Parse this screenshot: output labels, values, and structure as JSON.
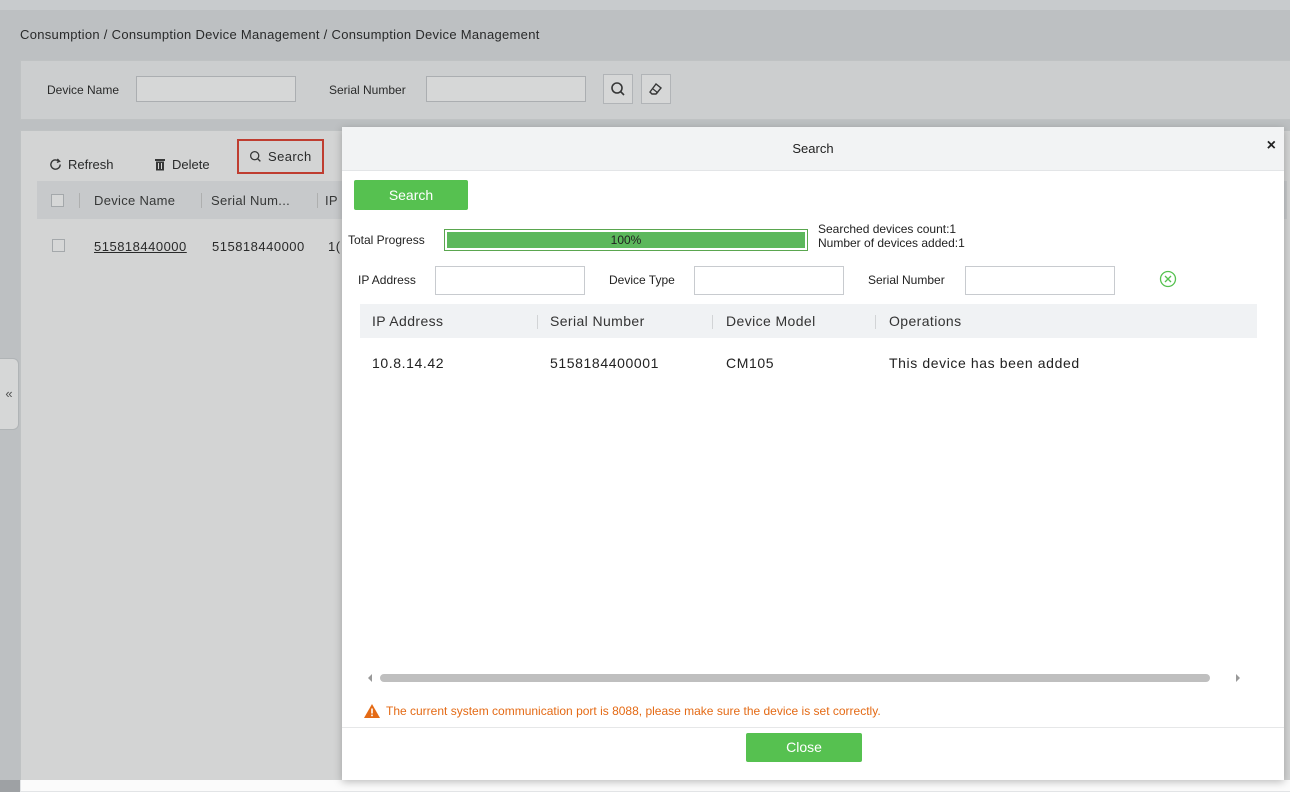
{
  "breadcrumb": "Consumption / Consumption Device Management / Consumption Device Management",
  "filter": {
    "device_name_label": "Device Name",
    "device_name_value": "",
    "serial_number_label": "Serial Number",
    "serial_number_value": ""
  },
  "toolbar": {
    "refresh": "Refresh",
    "delete": "Delete",
    "search": "Search"
  },
  "device_table": {
    "columns": [
      "Device Name",
      "Serial Num...",
      "IP"
    ],
    "rows": [
      {
        "device_name": "515818440000",
        "serial_number": "515818440000",
        "ip": "1("
      }
    ]
  },
  "collapse_glyph": "«",
  "modal": {
    "title": "Search",
    "close_glyph": "×",
    "search_button": "Search",
    "progress_label": "Total Progress",
    "progress_value": 1.0,
    "progress_text": "100%",
    "searched_count": "Searched devices count:1",
    "added_count": "Number of devices added:1",
    "filters": {
      "ip_label": "IP Address",
      "ip_value": "",
      "type_label": "Device Type",
      "type_value": "",
      "serial_label": "Serial Number",
      "serial_value": ""
    },
    "table": {
      "columns": [
        "IP Address",
        "Serial Number",
        "Device Model",
        "Operations"
      ],
      "rows": [
        {
          "ip": "10.8.14.42",
          "serial": "5158184400001",
          "model": "CM105",
          "operation": "This device has been added"
        }
      ]
    },
    "warning": "The current system communication port is 8088, please make sure the device is set correctly.",
    "close_button": "Close"
  },
  "colors": {
    "accent_green": "#56c150",
    "highlight_red": "#e23a2a",
    "warning_orange": "#e46a15"
  },
  "icons": {
    "search": "search-icon",
    "eraser": "eraser-icon",
    "refresh": "refresh-icon",
    "delete": "trash-icon",
    "clear": "clear-circle-icon",
    "warning": "warning-triangle-icon"
  }
}
